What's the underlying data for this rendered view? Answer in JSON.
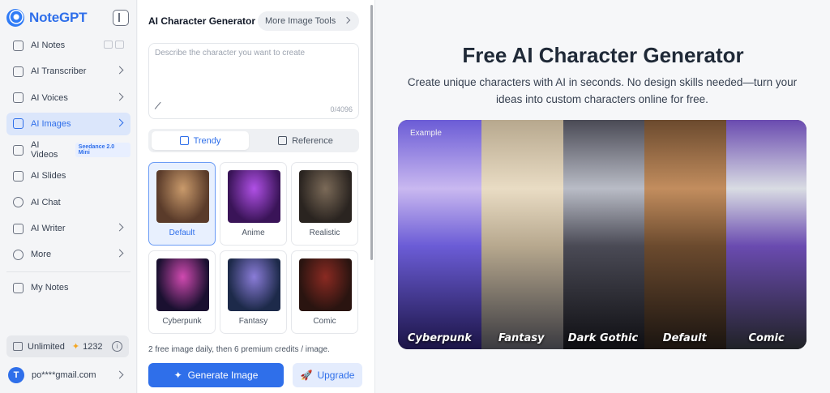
{
  "brand": {
    "name": "NoteGPT"
  },
  "sidebar": {
    "items": [
      {
        "label": "AI Notes",
        "icon": "notes-icon"
      },
      {
        "label": "AI Transcriber",
        "icon": "cc-icon",
        "chevron": true
      },
      {
        "label": "AI Voices",
        "icon": "waveform-icon",
        "chevron": true
      },
      {
        "label": "AI Images",
        "icon": "image-icon",
        "chevron": true,
        "active": true
      },
      {
        "label": "AI Videos",
        "icon": "video-icon",
        "badge": "Seedance 2.0 Mini"
      },
      {
        "label": "AI Slides",
        "icon": "slides-icon"
      },
      {
        "label": "AI Chat",
        "icon": "chat-icon"
      },
      {
        "label": "AI Writer",
        "icon": "pen-icon",
        "chevron": true
      },
      {
        "label": "More",
        "icon": "more-icon",
        "chevron": true
      }
    ],
    "my_notes": "My Notes",
    "usage": {
      "plan": "Unlimited",
      "credits": "1232"
    },
    "user": {
      "initial": "T",
      "email": "po****gmail.com"
    }
  },
  "panel": {
    "title": "AI Character Generator",
    "more_tools": "More Image Tools",
    "prompt": {
      "placeholder": "Describe the character you want to create",
      "value": "",
      "counter": "0/4096"
    },
    "tabs": [
      {
        "label": "Trendy"
      },
      {
        "label": "Reference"
      }
    ],
    "styles": [
      {
        "label": "Default",
        "selected": true,
        "colors": [
          "#5a3b2a",
          "#c99a6b"
        ]
      },
      {
        "label": "Anime",
        "colors": [
          "#3a1458",
          "#b050e6"
        ]
      },
      {
        "label": "Realistic",
        "colors": [
          "#2a2420",
          "#7b6a58"
        ]
      },
      {
        "label": "Cyberpunk",
        "colors": [
          "#1a1030",
          "#d04ab0"
        ]
      },
      {
        "label": "Fantasy",
        "colors": [
          "#1d2a4a",
          "#8a7cd8"
        ]
      },
      {
        "label": "Comic",
        "colors": [
          "#2a1410",
          "#8a2a22"
        ]
      }
    ],
    "credits_note": "2 free image daily, then 6 premium credits / image.",
    "generate_label": "Generate Image",
    "upgrade_label": "Upgrade"
  },
  "hero": {
    "title": "Free AI Character Generator",
    "subtitle": "Create unique characters with AI in seconds. No design skills needed—turn your ideas into custom characters online for free.",
    "example_tag": "Example",
    "panels": [
      {
        "label": "Cyberpunk",
        "colors": [
          "#1b1446",
          "#6b5cd6",
          "#c9b8f0"
        ]
      },
      {
        "label": "Fantasy",
        "colors": [
          "#3a3a40",
          "#b7a88e",
          "#e9dcc4"
        ]
      },
      {
        "label": "Dark Gothic",
        "colors": [
          "#0e0e12",
          "#4a4a55",
          "#b9bcc6"
        ]
      },
      {
        "label": "Default",
        "colors": [
          "#1a1410",
          "#6b4a2e",
          "#c28d5e"
        ]
      },
      {
        "label": "Comic",
        "colors": [
          "#202226",
          "#6a4bb0",
          "#d9dce3"
        ]
      }
    ]
  }
}
